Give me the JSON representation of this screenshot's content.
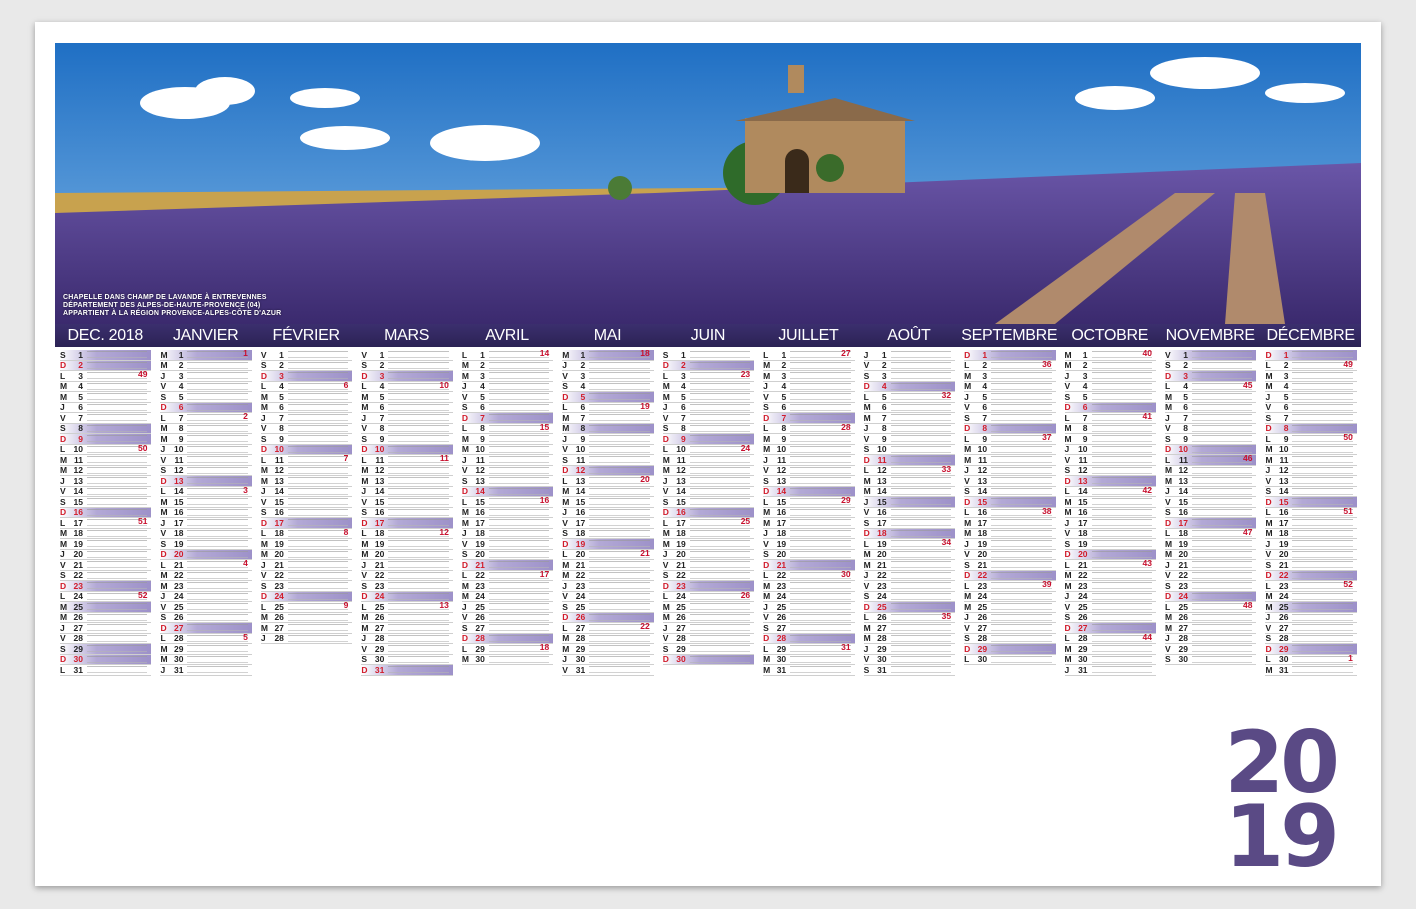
{
  "caption": "CHAPELLE DANS CHAMP DE LAVANDE À ENTREVENNES\nDÉPARTEMENT DES ALPES-DE-HAUTE-PROVENCE (04)\nAPPARTIENT À LA RÉGION PROVENCE-ALPES-CÔTE D'AZUR",
  "year_top": "20",
  "year_bottom": "19",
  "colors": {
    "header": "#2b2254",
    "holiday": "#9d91c9",
    "sunday": "#d11b2a",
    "year": "#5a4a85",
    "lavender": "#5b3f9a"
  },
  "months": [
    {
      "name": "DEC. 2018",
      "days": 31,
      "start": 5,
      "weeks": {
        "3": "49",
        "10": "50",
        "17": "51",
        "24": "52"
      },
      "hol": [
        1,
        8,
        25,
        29
      ]
    },
    {
      "name": "JANVIER",
      "days": 31,
      "start": 1,
      "weeks": {
        "1": "1",
        "7": "2",
        "14": "3",
        "21": "4",
        "28": "5"
      },
      "hol": [
        1,
        6
      ]
    },
    {
      "name": "FÉVRIER",
      "days": 28,
      "start": 4,
      "weeks": {
        "4": "6",
        "11": "7",
        "18": "8",
        "25": "9"
      },
      "hol": [
        3,
        10,
        17,
        24
      ]
    },
    {
      "name": "MARS",
      "days": 31,
      "start": 4,
      "weeks": {
        "4": "10",
        "11": "11",
        "18": "12",
        "25": "13"
      },
      "hol": [
        3,
        10,
        17,
        24,
        31
      ]
    },
    {
      "name": "AVRIL",
      "days": 30,
      "start": 0,
      "weeks": {
        "1": "14",
        "8": "15",
        "15": "16",
        "22": "17",
        "29": "18"
      },
      "hol": [
        7,
        14,
        21,
        28
      ]
    },
    {
      "name": "MAI",
      "days": 31,
      "start": 2,
      "weeks": {
        "1": "18",
        "6": "19",
        "13": "20",
        "20": "21",
        "27": "22"
      },
      "hol": [
        1,
        5,
        8,
        12,
        19,
        26
      ]
    },
    {
      "name": "JUIN",
      "days": 30,
      "start": 5,
      "weeks": {
        "3": "23",
        "10": "24",
        "17": "25",
        "24": "26"
      },
      "hol": [
        2,
        9,
        16,
        23,
        30
      ]
    },
    {
      "name": "JUILLET",
      "days": 31,
      "start": 0,
      "weeks": {
        "1": "27",
        "8": "28",
        "15": "29",
        "22": "30",
        "29": "31"
      },
      "hol": [
        7,
        14,
        21,
        28
      ]
    },
    {
      "name": "AOÛT",
      "days": 31,
      "start": 3,
      "weeks": {
        "5": "32",
        "12": "33",
        "19": "34",
        "26": "35"
      },
      "hol": [
        4,
        11,
        15,
        18,
        25
      ]
    },
    {
      "name": "SEPTEMBRE",
      "days": 30,
      "start": 6,
      "weeks": {
        "2": "36",
        "9": "37",
        "16": "38",
        "23": "39"
      },
      "hol": [
        1,
        8,
        15,
        22,
        29
      ]
    },
    {
      "name": "OCTOBRE",
      "days": 31,
      "start": 1,
      "weeks": {
        "1": "40",
        "7": "41",
        "14": "42",
        "21": "43",
        "28": "44"
      },
      "hol": [
        6,
        13,
        20,
        27
      ]
    },
    {
      "name": "NOVEMBRE",
      "days": 30,
      "start": 4,
      "weeks": {
        "4": "45",
        "11": "46",
        "18": "47",
        "25": "48"
      },
      "hol": [
        1,
        3,
        10,
        11,
        17,
        24
      ]
    },
    {
      "name": "DÉCEMBRE",
      "days": 31,
      "start": 6,
      "weeks": {
        "2": "49",
        "9": "50",
        "16": "51",
        "23": "52",
        "30": "1"
      },
      "hol": [
        1,
        8,
        15,
        22,
        25,
        29
      ]
    }
  ],
  "day_letters": [
    "L",
    "M",
    "M",
    "J",
    "V",
    "S",
    "D"
  ]
}
